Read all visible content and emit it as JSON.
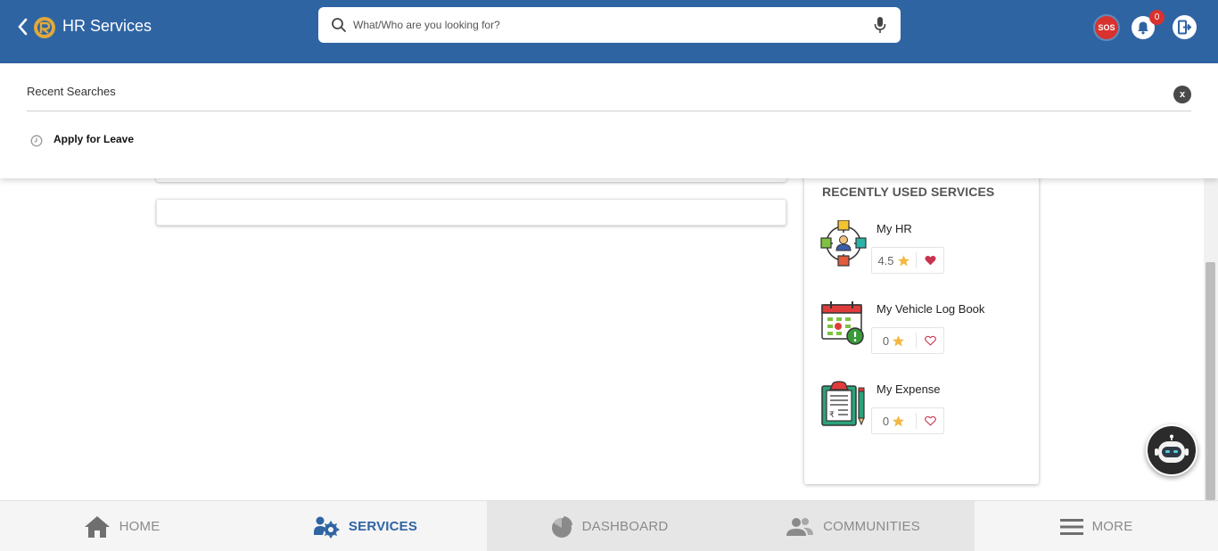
{
  "header": {
    "title": "HR Services",
    "search_placeholder": "What/Who are you looking for?",
    "sos_label": "SOS",
    "notification_count": "0"
  },
  "recent_searches": {
    "title": "Recent Searches",
    "close_label": "x",
    "items": [
      "Apply for Leave"
    ]
  },
  "recently_used": {
    "title": "RECENTLY USED SERVICES",
    "services": [
      {
        "name": "My HR",
        "rating": "4.5",
        "favorited": true
      },
      {
        "name": "My Vehicle Log Book",
        "rating": "0",
        "favorited": false
      },
      {
        "name": "My Expense",
        "rating": "0",
        "favorited": false
      }
    ]
  },
  "bottom_nav": {
    "home": "HOME",
    "services": "SERVICES",
    "dashboard": "DASHBOARD",
    "communities": "COMMUNITIES",
    "more": "MORE"
  },
  "colors": {
    "brand": "#2f64a3",
    "alert": "#d8322f",
    "star": "#f4b740",
    "heart": "#c8334f"
  }
}
